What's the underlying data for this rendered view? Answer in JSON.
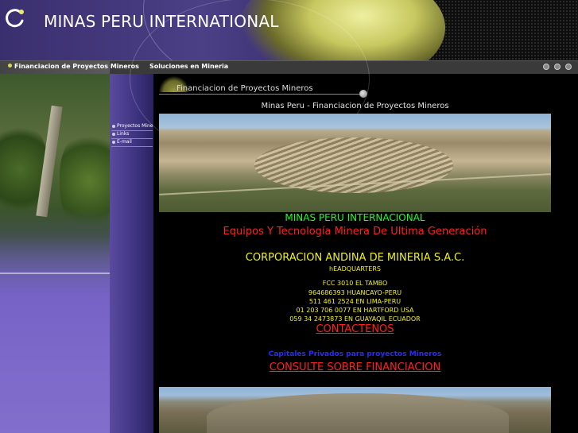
{
  "header": {
    "title": "MINAS PERU INTERNATIONAL"
  },
  "nav": {
    "items": [
      {
        "label": "Financiacion de Proyectos Mineros"
      },
      {
        "label": "Soluciones en Mineria"
      }
    ]
  },
  "sidebar": {
    "items": [
      {
        "label": "Proyectos Mineros"
      },
      {
        "label": "Links"
      },
      {
        "label": "E-mail"
      }
    ]
  },
  "section": {
    "title": "Financiacion de Proyectos Mineros"
  },
  "main": {
    "heading": "Minas Peru - Financiacion de Proyectos Mineros",
    "company_name": "MINAS PERU INTERNACIONAL",
    "tagline": "Equipos Y Tecnología Minera De Ultima Generación",
    "corp_name": "CORPORACION ANDINA DE MINERIA S.A.C.",
    "hq_label": "hEADQUARTERS",
    "address_lines": [
      "FCC 3010 EL TAMBO",
      "964686393  HUANCAYO-PERU",
      "511 461 2524  EN LIMA-PERU",
      "01  203  706  0077 EN HARTFORD USA",
      "059 34 2473873  EN GUAYAQIL ECUADOR"
    ],
    "contact_link": "CONTACTENOS",
    "capitales": "Capitales Privados para proyectos Mineros",
    "consult_link": "CONSULTE SOBRE FINANCIACION"
  },
  "colors": {
    "green_text": "#1aff1a",
    "red_text": "#ff2020",
    "yellow_text": "#f2f21a",
    "blue_text": "#2a2aff",
    "purple_accent": "#4b3f86"
  }
}
